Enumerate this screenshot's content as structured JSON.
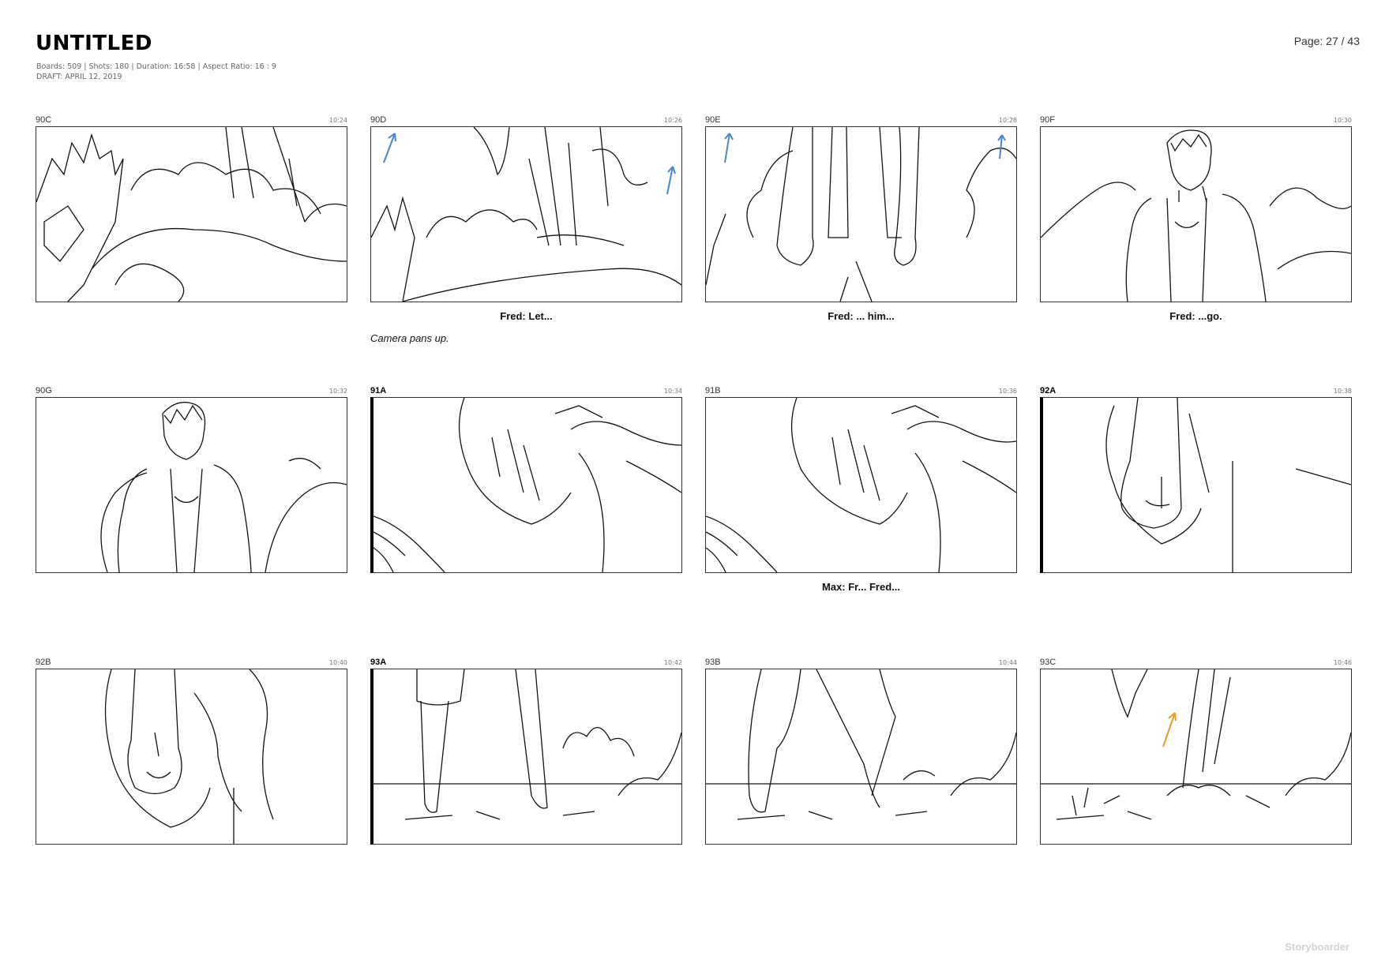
{
  "header": {
    "title": "UNTITLED",
    "meta_line1": "Boards: 509  |  Shots: 180  |  Duration: 16:58  |  Aspect Ratio: 16 : 9",
    "meta_line2": "DRAFT: APRIL 12, 2019",
    "page": "Page: 27 / 43"
  },
  "boards": [
    {
      "id": "90C",
      "time": "10:24",
      "dialogue": "",
      "action": ""
    },
    {
      "id": "90D",
      "time": "10:26",
      "dialogue": "Fred: Let...",
      "action": "Camera pans up."
    },
    {
      "id": "90E",
      "time": "10:28",
      "dialogue": "Fred: ... him...",
      "action": ""
    },
    {
      "id": "90F",
      "time": "10:30",
      "dialogue": "Fred: ...go.",
      "action": ""
    },
    {
      "id": "90G",
      "time": "10:32",
      "dialogue": "",
      "action": ""
    },
    {
      "id": "91A",
      "time": "10:34",
      "dialogue": "",
      "action": ""
    },
    {
      "id": "91B",
      "time": "10:36",
      "dialogue": "Max: Fr... Fred...",
      "action": ""
    },
    {
      "id": "92A",
      "time": "10:38",
      "dialogue": "",
      "action": ""
    },
    {
      "id": "92B",
      "time": "10:40",
      "dialogue": "",
      "action": ""
    },
    {
      "id": "93A",
      "time": "10:42",
      "dialogue": "",
      "action": ""
    },
    {
      "id": "93B",
      "time": "10:44",
      "dialogue": "",
      "action": ""
    },
    {
      "id": "93C",
      "time": "10:46",
      "dialogue": "",
      "action": ""
    }
  ],
  "footer": {
    "brand": "Storyboarder"
  },
  "colors": {
    "arrow_blue": "#4a86c5",
    "arrow_orange": "#e89a2c",
    "ink": "#111111"
  }
}
